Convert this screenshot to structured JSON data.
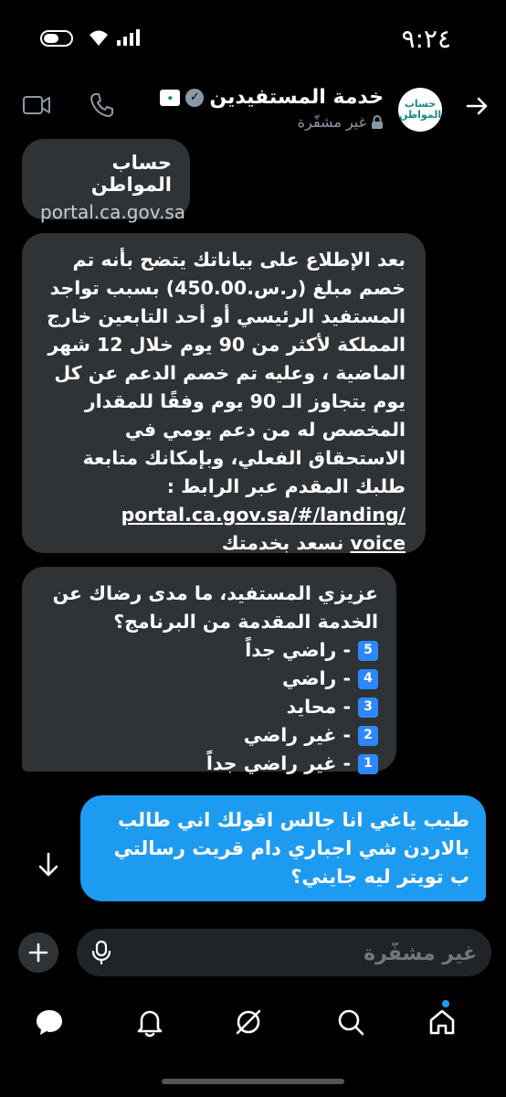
{
  "status_bar": {
    "time": "٩:٢٤"
  },
  "header": {
    "name": "خدمة المستفيدين",
    "subtitle": "غير مشفّرة",
    "avatar_text": "حساب المواطن"
  },
  "messages": [
    {
      "title": "حساب المواطن",
      "link": "portal.ca.gov.sa"
    },
    {
      "body": "بعد الإطلاع على بياناتك يتضح بأنه تم خصم مبلغ (ر.س.450.00) بسبب تواجد المستفيد الرئيسي أو أحد التابعين خارج المملكة لأكثر من 90 يوم خلال 12 شهر الماضية ، وعليه تم خصم الدعم عن كل يوم يتجاوز الـ 90 يوم وفقًا للمقدار المخصص له من دعم يومي في الاستحقاق الفعلي، وبإمكانك متابعة طلبك المقدم عبر الرابط :",
      "link": "portal.ca.gov.sa/#/landing/",
      "link2": "voice",
      "closing": " نسعد بخدمتك"
    },
    {
      "question": "عزيزي المستفيد، ما مدى رضاك عن الخدمة المقدمة من البرنامج؟",
      "options": [
        {
          "key": "5",
          "label": "- راضي جداً"
        },
        {
          "key": "4",
          "label": "- راضي"
        },
        {
          "key": "3",
          "label": "- محايد"
        },
        {
          "key": "2",
          "label": "- غير راضي"
        },
        {
          "key": "1",
          "label": "- غير راضي جداً"
        }
      ]
    },
    {
      "body": "طيب ياغي انا جالس اقولك اني طالب بالاردن شي اجباري دام قريت رسالتي ب تويتر ليه جايني؟"
    }
  ],
  "composer": {
    "placeholder": "غير مشفّرة"
  }
}
